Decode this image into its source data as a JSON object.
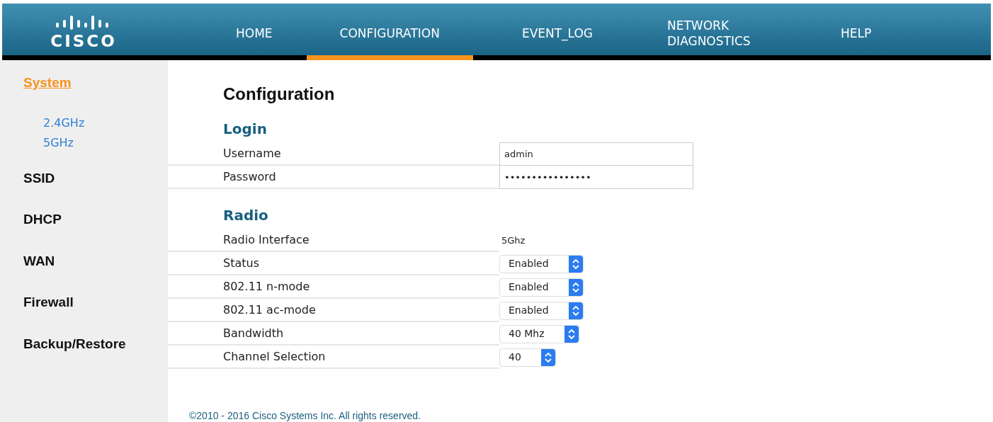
{
  "logo": {
    "text": "CISCO"
  },
  "nav": [
    {
      "label": "HOME",
      "selected": false
    },
    {
      "label": "CONFIGURATION",
      "selected": true
    },
    {
      "label": "EVENT_LOG",
      "selected": false
    },
    {
      "label": "NETWORK DIAGNOSTICS",
      "selected": false
    },
    {
      "label": "HELP",
      "selected": false
    }
  ],
  "sidebar": {
    "items": [
      {
        "label": "System",
        "selected": true,
        "children": [
          {
            "label": "2.4GHz"
          },
          {
            "label": "5GHz"
          }
        ]
      },
      {
        "label": "SSID",
        "selected": false
      },
      {
        "label": "DHCP",
        "selected": false
      },
      {
        "label": "WAN",
        "selected": false
      },
      {
        "label": "Firewall",
        "selected": false
      },
      {
        "label": "Backup/Restore",
        "selected": false
      }
    ]
  },
  "page_title": "Configuration",
  "sections": [
    {
      "title": "Login",
      "rows": [
        {
          "label": "Username",
          "kind": "text",
          "value": "admin"
        },
        {
          "label": "Password",
          "kind": "password",
          "value": "••••••••••••••••"
        }
      ]
    },
    {
      "title": "Radio",
      "rows": [
        {
          "label": "Radio Interface",
          "kind": "static",
          "value": "5Ghz"
        },
        {
          "label": "Status",
          "kind": "select",
          "value": "Enabled"
        },
        {
          "label": "802.11 n-mode",
          "kind": "select",
          "value": "Enabled"
        },
        {
          "label": "802.11 ac-mode",
          "kind": "select",
          "value": "Enabled"
        },
        {
          "label": "Bandwidth",
          "kind": "select",
          "value": "40 Mhz"
        },
        {
          "label": "Channel Selection",
          "kind": "select",
          "value": "40"
        }
      ]
    }
  ],
  "footer": "©2010 - 2016 Cisco Systems Inc. All rights reserved."
}
